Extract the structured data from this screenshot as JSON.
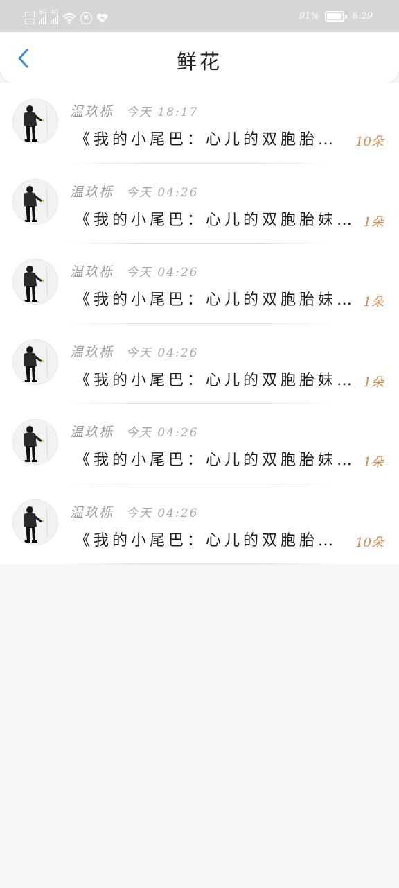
{
  "status_bar": {
    "network_label_1": "5G",
    "network_label_2": "4G",
    "battery": "91%",
    "battery_level": 0.91,
    "time": "6:29"
  },
  "header": {
    "title": "鲜花",
    "back_icon": "chevron-left-icon",
    "accent_color": "#3b8fd6"
  },
  "items": [
    {
      "name": "温玖栎",
      "time": "今天 18:17",
      "message": "《我的小尾巴：心儿的双胞胎…",
      "count": "10朵"
    },
    {
      "name": "温玖栎",
      "time": "今天 04:26",
      "message": "《我的小尾巴：心儿的双胞胎妹…",
      "count": "1朵"
    },
    {
      "name": "温玖栎",
      "time": "今天 04:26",
      "message": "《我的小尾巴：心儿的双胞胎妹…",
      "count": "1朵"
    },
    {
      "name": "温玖栎",
      "time": "今天 04:26",
      "message": "《我的小尾巴：心儿的双胞胎妹…",
      "count": "1朵"
    },
    {
      "name": "温玖栎",
      "time": "今天 04:26",
      "message": "《我的小尾巴：心儿的双胞胎妹…",
      "count": "1朵"
    },
    {
      "name": "温玖栎",
      "time": "今天 04:26",
      "message": "《我的小尾巴：心儿的双胞胎…",
      "count": "10朵"
    }
  ],
  "colors": {
    "count_color": "#d48a4b",
    "status_bar_bg": "#d6d6d6"
  }
}
